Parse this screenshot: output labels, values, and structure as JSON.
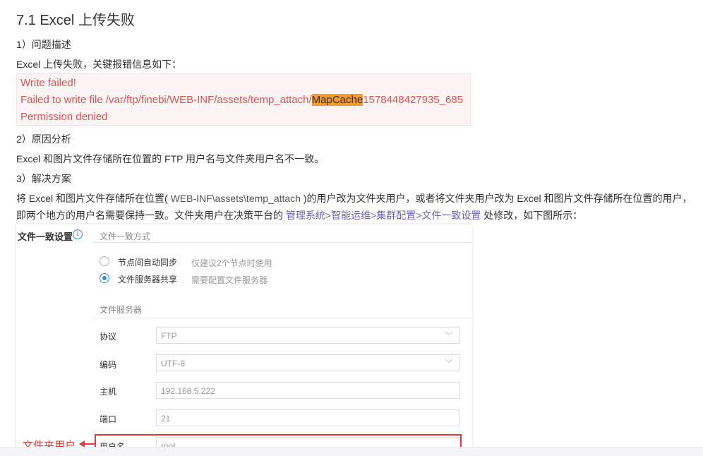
{
  "heading": "7.1 Excel 上传失败",
  "s1_title": "1）问题描述",
  "s1_text": "Excel 上传失败，关键报错信息如下：",
  "error": {
    "line1": "Write failed!",
    "line2_pre": "Failed to write file /var/ftp/finebi/WEB-INF/assets/temp_attach/",
    "line2_hl": "MapCache",
    "line2_post": "1578448427935_685",
    "line3": "Permission denied"
  },
  "s2_title": "2）原因分析",
  "s2_text": "Excel 和图片文件存储所在位置的 FTP 用户名与文件夹用户名不一致。",
  "s3_title": "3）解决方案",
  "s3_p1_a": "将 Excel 和图片文件存储所在位置( ",
  "s3_p1_code": "WEB-INF\\assets\\temp_attach",
  "s3_p1_b": " )的用户改为文件夹用户，或者将文件夹用户改为 Excel 和图片文件存储所在位置的用户，",
  "s3_p2_a": "即两个地方的用户名需要保持一致。文件夹用户在决策平台的 ",
  "s3_p2_link": "管理系统>智能运维>集群配置>文件一致设置",
  "s3_p2_b": " 处修改，如下图所示：",
  "panel": {
    "title": "文件一致设置",
    "info_icon": "i",
    "mode_label": "文件一致方式",
    "option1": "节点间自动同步",
    "option1_hint": "仅建议2个节点时使用",
    "option2": "文件服务器共享",
    "option2_hint": "需要配置文件服务器",
    "server_section": "文件服务器",
    "fields": {
      "protocol_label": "协议",
      "protocol_value": "FTP",
      "encoding_label": "编码",
      "encoding_value": "UTF-8",
      "host_label": "主机",
      "host_value": "192.168.5.222",
      "port_label": "端口",
      "port_value": "21",
      "user_label": "用户名",
      "user_value": "root"
    },
    "chevron": "﹀"
  },
  "callout": "文件夹用户",
  "colors": {
    "error_text": "#d9534f",
    "highlight": "#f59a2f",
    "link": "#6e5fb5",
    "accent": "#3a86e0",
    "annotation": "#e03b3b"
  }
}
